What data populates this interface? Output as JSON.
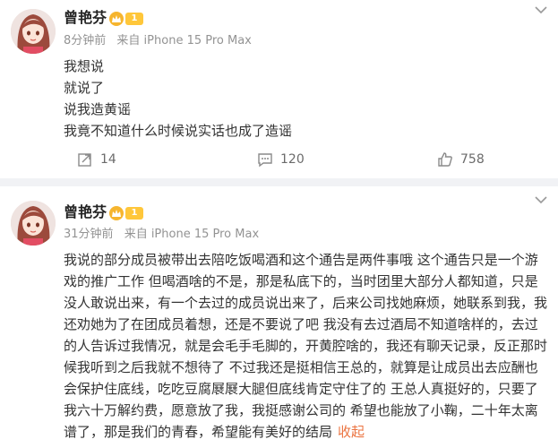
{
  "posts": [
    {
      "author": "曾艳芬",
      "level": "1",
      "time": "8分钟前",
      "source": "来自 iPhone 15 Pro Max",
      "lines": [
        "我想说",
        "就说了",
        "说我造黄谣",
        "我竟不知道什么时候说实话也成了造谣"
      ],
      "reposts": "14",
      "comments": "120",
      "likes": "758"
    },
    {
      "author": "曾艳芬",
      "level": "1",
      "time": "31分钟前",
      "source": "来自 iPhone 15 Pro Max",
      "lines": [
        "我说的部分成员被带出去陪吃饭喝酒和这个通告是两件事哦 这个通告只是一个游",
        "戏的推广工作 但喝酒啥的不是，那是私底下的，当时团里大部分人都知道，只是",
        "没人敢说出来，有一个去过的成员说出来了，后来公司找她麻烦，她联系到我，我",
        "还劝她为了在团成员着想，还是不要说了吧 我没有去过酒局不知道啥样的，去过",
        "的人告诉过我情况，就是会毛手毛脚的，开黄腔啥的，我还有聊天记录，反正那时",
        "候我听到之后我就不想待了 不过我还是挺相信王总的，就算是让成员出去应酬也",
        "会保护住底线，吃吃豆腐㞡㞡大腿但底线肯定守住了的 王总人真挺好的，只要了",
        "我六十万解约费，愿意放了我，我挺感谢公司的 希望也能放了小鞠，二十年太离",
        "谱了，那是我们的青春，希望能有美好的结局"
      ],
      "collapse": "收起"
    }
  ],
  "colors": {
    "accent": "#eb7340",
    "muted": "#939393",
    "badge": "#ffc73a"
  }
}
